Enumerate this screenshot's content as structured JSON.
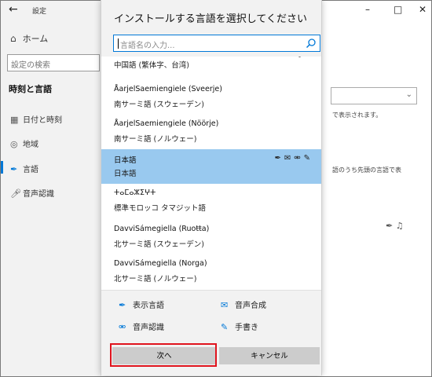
{
  "settings": {
    "app_title": "設定",
    "home_label": "ホーム",
    "search_placeholder": "設定の検索",
    "section_title": "時刻と言語",
    "nav_items": [
      {
        "label": "日付と時刻",
        "icon": "calendar-icon"
      },
      {
        "label": "地域",
        "icon": "globe-icon"
      },
      {
        "label": "言語",
        "icon": "language-icon",
        "active": true
      },
      {
        "label": "音声認識",
        "icon": "microphone-icon"
      }
    ],
    "right_texts": [
      "で表示されます。",
      "語のうち先頭の言語で表"
    ],
    "window_controls": [
      "minimize",
      "maximize",
      "close"
    ]
  },
  "dialog": {
    "title": "インストールする言語を選択してください",
    "search_placeholder": "言語名の入力...",
    "languages": [
      {
        "native": "",
        "japanese": "中国語 (繁体字、台湾)"
      },
      {
        "native": "ÅarjelSaemiengiele (Sveerje)",
        "japanese": "南サーミ語 (スウェーデン)"
      },
      {
        "native": "ÅarjelSaemiengiele (Nöörje)",
        "japanese": "南サーミ語 (ノルウェー)"
      },
      {
        "native": "日本語",
        "japanese": "日本語",
        "selected": true
      },
      {
        "native": "ⵜⴰⵎⴰⵣⵉⵖⵜ",
        "japanese": "標準モロッコ タマジット語"
      },
      {
        "native": "DavviSámegiella (Ruoŧŧa)",
        "japanese": "北サーミ語 (スウェーデン)"
      },
      {
        "native": "DavviSámegiella (Norga)",
        "japanese": "北サーミ語 (ノルウェー)"
      }
    ],
    "legend": {
      "display_language": "表示言語",
      "text_to_speech": "音声合成",
      "speech_recognition": "音声認識",
      "handwriting": "手書き"
    },
    "buttons": {
      "next": "次へ",
      "cancel": "キャンセル"
    }
  },
  "colors": {
    "accent": "#0078d7",
    "selected_row": "#99c9ef",
    "highlight_box": "#e0141e",
    "button_bg": "#cccccc"
  }
}
